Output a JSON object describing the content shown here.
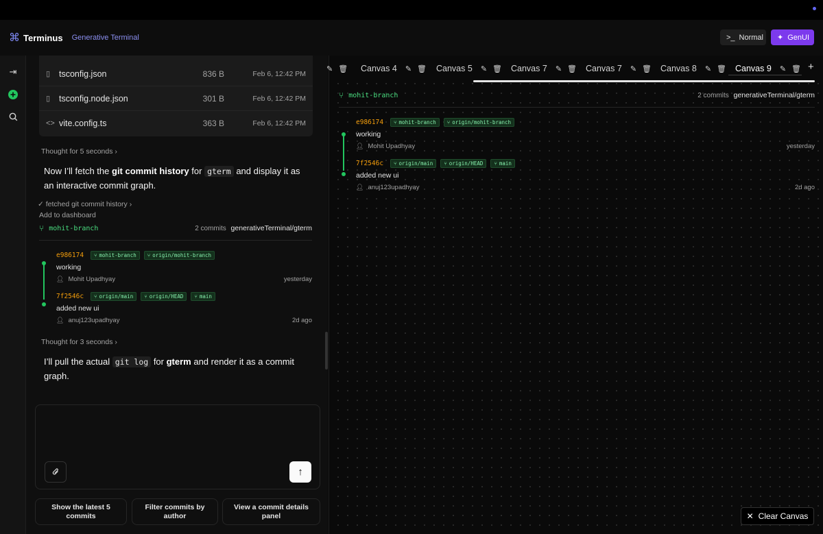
{
  "app": {
    "name": "Terminus",
    "subtitle": "Generative Terminal"
  },
  "modes": {
    "normal": "Normal",
    "genui": "GenUI"
  },
  "files": [
    {
      "name": "tsconfig.json",
      "size": "836 B",
      "date": "Feb 6, 12:42 PM",
      "icon": "file-icon"
    },
    {
      "name": "tsconfig.node.json",
      "size": "301 B",
      "date": "Feb 6, 12:42 PM",
      "icon": "file-icon"
    },
    {
      "name": "vite.config.ts",
      "size": "363 B",
      "date": "Feb 6, 12:42 PM",
      "icon": "code-icon"
    }
  ],
  "chat": {
    "thought1": "Thought for 5 seconds",
    "msg1": {
      "part1": "Now I’ll fetch the ",
      "bold1": "git commit history",
      "part2": " for ",
      "code1": "gterm",
      "part3": " and display it as an interactive commit graph."
    },
    "tool_status": "fetched git commit history",
    "add_dashboard": "Add to dashboard",
    "thought2": "Thought for 3 seconds",
    "msg2": {
      "part1": "I’ll pull the actual ",
      "code1": "git log",
      "part2": " for ",
      "bold1": "gterm",
      "part3": " and render it as a commit graph."
    }
  },
  "graph": {
    "branch": "mohit-branch",
    "commit_count": "2 commits",
    "repo": "generativeTerminal/gterm",
    "commits": [
      {
        "hash": "e986174",
        "tags": [
          "mohit-branch",
          "origin/mohit-branch"
        ],
        "message": "working",
        "author": "Mohit Upadhyay",
        "when": "yesterday"
      },
      {
        "hash": "7f2546c",
        "tags": [
          "origin/main",
          "origin/HEAD",
          "main"
        ],
        "message": "added new ui",
        "author": "anuj123upadhyay",
        "when": "2d ago"
      }
    ]
  },
  "suggestions": [
    "Show the latest 5 commits",
    "Filter commits by author",
    "View a commit details panel"
  ],
  "tabs": [
    "Canvas 4",
    "Canvas 5",
    "Canvas 7",
    "Canvas 7",
    "Canvas 8",
    "Canvas 9"
  ],
  "active_tab": "Canvas 9",
  "clear_canvas": "Clear Canvas",
  "colors": {
    "accent": "#7c3aed",
    "branch": "#22c55e",
    "hash": "#f59e0b"
  }
}
